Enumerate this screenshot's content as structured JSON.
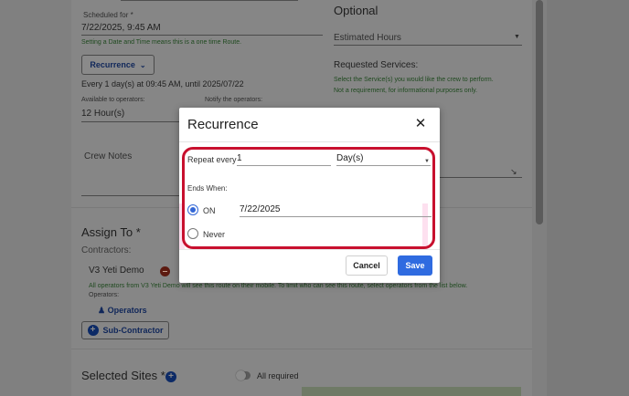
{
  "background": {
    "scheduled_for_label": "Scheduled for",
    "required_marker": "*",
    "scheduled_for_value": "7/22/2025, 9:45 AM",
    "one_time_note": "Setting a Date and Time means this is a one time Route.",
    "recurrence_button": "Recurrence",
    "recurrence_summary": "Every 1 day(s) at 09:45 AM, until 2025/07/22",
    "available_label": "Available to operators:",
    "available_value": "12 Hour(s)",
    "notify_label": "Notify the operators:",
    "crew_notes_label": "Crew Notes",
    "optional_title": "Optional",
    "estimated_hours_label": "Estimated Hours",
    "requested_services_label": "Requested Services:",
    "services_note_1": "Select the Service(s) you would like the crew to perform.",
    "services_note_2": "Not a requirement, for informational purposes only.",
    "assign_to_title": "Assign To *",
    "contractors_label": "Contractors:",
    "contractor_name": "V3 Yeti Demo",
    "contractor_note": "All operators from V3 Yeti Demo will see this route on their mobile. To limit who can see this route, select operators from the list below.",
    "operators_label": "Operators:",
    "operators_button": "Operators",
    "subcontractor_button": "Sub-Contractor",
    "selected_sites_title": "Selected Sites *",
    "all_required_label": "All required"
  },
  "modal": {
    "title": "Recurrence",
    "repeat_every_label": "Repeat every",
    "repeat_every_value": "1",
    "period_value": "Day(s)",
    "ends_when_label": "Ends When:",
    "on_label": "ON",
    "on_date_value": "7/22/2025",
    "never_label": "Never",
    "cancel_label": "Cancel",
    "save_label": "Save",
    "selected_end_option": "ON"
  },
  "colors": {
    "accent": "#2f6be0",
    "highlight_border": "#c8102e",
    "green_note": "#1f4a1f"
  }
}
